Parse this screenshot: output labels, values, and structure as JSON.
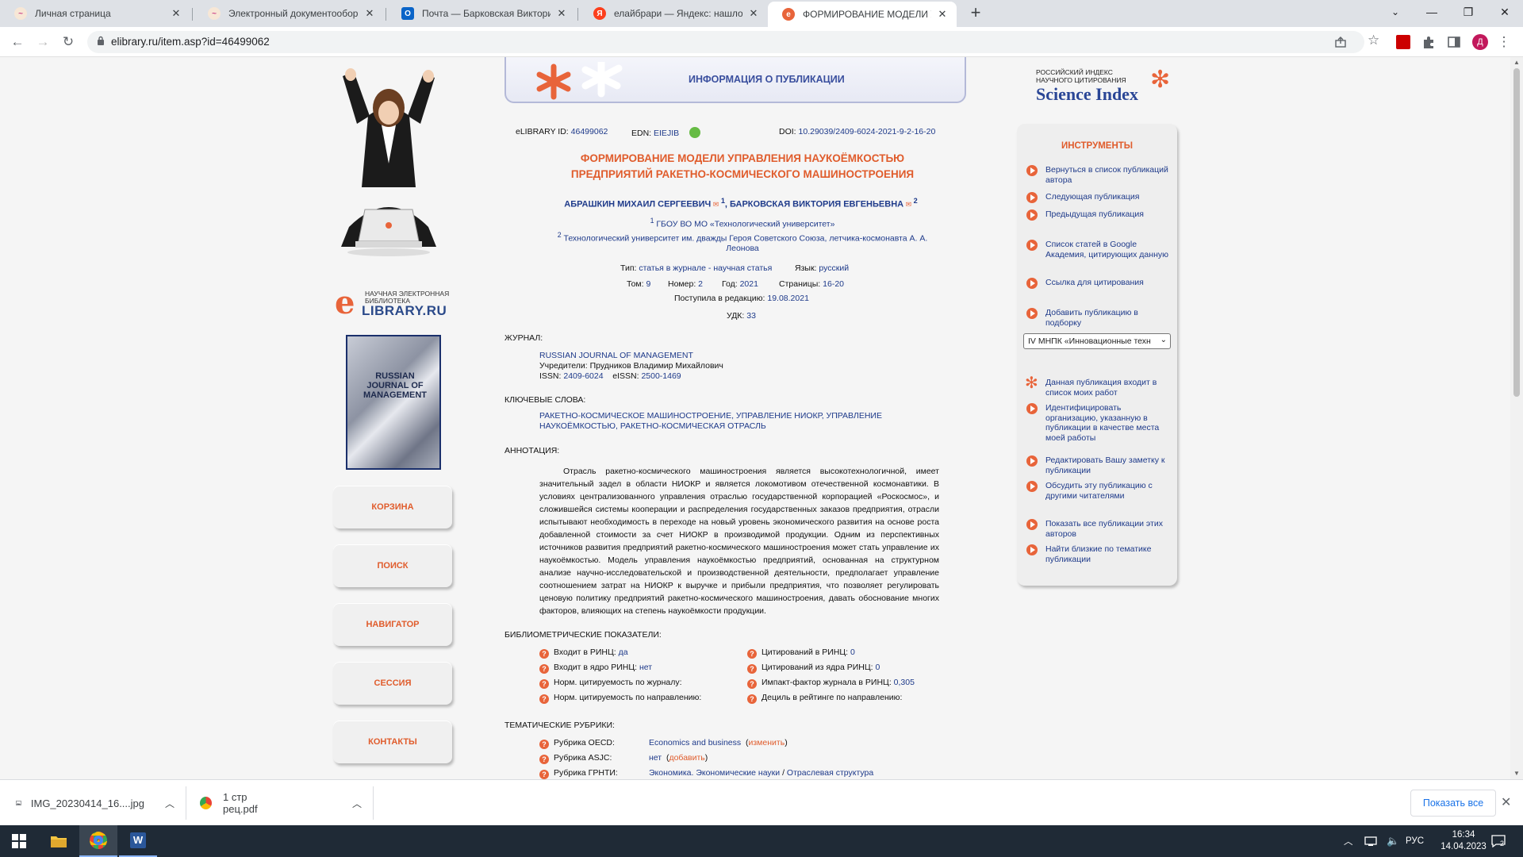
{
  "browser": {
    "tabs": [
      {
        "title": "Личная страница",
        "active": false
      },
      {
        "title": "Электронный документооборот",
        "active": false
      },
      {
        "title": "Почта — Барковская Виктория",
        "active": false
      },
      {
        "title": "елайбрари — Яндекс: нашлось",
        "active": false
      },
      {
        "title": "ФОРМИРОВАНИЕ МОДЕЛИ УПРА",
        "active": true
      }
    ],
    "url": "elibrary.ru/item.asp?id=46499062",
    "profile_initial": "Д"
  },
  "left": {
    "logo_small": "НАУЧНАЯ ЭЛЕКТРОННАЯ БИБЛИОТЕКА",
    "logo_big": "LIBRARY.RU",
    "logo_e": "e",
    "cover_title": "RUSSIAN JOURNAL OF MANAGEMENT",
    "nav": [
      "КОРЗИНА",
      "ПОИСК",
      "НАВИГАТОР",
      "СЕССИЯ",
      "КОНТАКТЫ"
    ]
  },
  "banner": {
    "title": "ИНФОРМАЦИЯ О ПУБЛИКАЦИИ"
  },
  "publication": {
    "elibrary_id_label": "eLIBRARY ID:",
    "elibrary_id": "46499062",
    "edn_label": "EDN:",
    "edn": "EIEJIB",
    "doi_label": "DOI:",
    "doi": "10.29039/2409-6024-2021-9-2-16-20",
    "title_line1": "ФОРМИРОВАНИЕ МОДЕЛИ УПРАВЛЕНИЯ НАУКОЁМКОСТЬЮ",
    "title_line2": "ПРЕДПРИЯТИЙ РАКЕТНО-КОСМИЧЕСКОГО МАШИНОСТРОЕНИЯ",
    "author1": "АБРАШКИН МИХАИЛ СЕРГЕЕВИЧ",
    "author1_sup": "1",
    "author2": "БАРКОВСКАЯ ВИКТОРИЯ ЕВГЕНЬЕВНА",
    "author2_sup": "2",
    "aff1_num": "1",
    "aff1": "ГБОУ ВО МО «Технологический университет»",
    "aff2_num": "2",
    "aff2": "Технологический университет им. дважды Героя Советского Союза, летчика-космонавта А. А. Леонова",
    "type_label": "Тип:",
    "type": "статья в журнале - научная статья",
    "lang_label": "Язык:",
    "lang": "русский",
    "vol_label": "Том:",
    "vol": "9",
    "num_label": "Номер:",
    "num": "2",
    "year_label": "Год:",
    "year": "2021",
    "pages_label": "Страницы:",
    "pages": "16-20",
    "received_label": "Поступила в редакцию:",
    "received": "19.08.2021",
    "udk_label": "УДК:",
    "udk": "33"
  },
  "journal": {
    "section": "ЖУРНАЛ:",
    "name": "RUSSIAN JOURNAL OF MANAGEMENT",
    "founder_label": "Учредители:",
    "founder": "Прудников Владимир Михайлович",
    "issn_label": "ISSN:",
    "issn": "2409-6024",
    "eissn_label": "eISSN:",
    "eissn": "2500-1469"
  },
  "keywords": {
    "section": "КЛЮЧЕВЫЕ СЛОВА:",
    "line1": "РАКЕТНО-КОСМИЧЕСКОЕ МАШИНОСТРОЕНИЕ, УПРАВЛЕНИЕ НИОКР, УПРАВЛЕНИЕ",
    "line2": "НАУКОЁМКОСТЬЮ, РАКЕТНО-КОСМИЧЕСКАЯ ОТРАСЛЬ"
  },
  "abstract": {
    "section": "АННОТАЦИЯ:",
    "text": "Отрасль ракетно-космического машиностроения является высокотехнологичной, имеет значительный задел в области НИОКР и является локомотивом отечественной космонавтики. В условиях централизованного управления отраслью государственной корпорацией «Роскосмос», и сложившейся системы кооперации и распределения государственных заказов предприятия, отрасли испытывают необходимость в переходе на новый уровень экономического развития на основе роста добавленной стоимости за счет НИОКР в производимой продукции. Одним из перспективных источников развития предприятий ракетно-космического машиностроения может стать управление их наукоёмкостью. Модель управления наукоёмкостью предприятий, основанная на структурном анализе научно-исследовательской и производственной деятельности, предполагает управление соотношением затрат на НИОКР к выручке и прибыли предприятия, что позволяет регулировать ценовую политику предприятий ракетно-космического машиностроения, давать обоснование многих факторов, влияющих на степень наукоёмкости продукции."
  },
  "bibliometrics": {
    "section": "БИБЛИОМЕТРИЧЕСКИЕ ПОКАЗАТЕЛИ:",
    "rinc_label": "Входит в РИНЦ:",
    "rinc": "да",
    "core_label": "Входит в ядро РИНЦ:",
    "core": "нет",
    "norm_journal_label": "Норм. цитируемость по журналу:",
    "norm_dir_label": "Норм. цитируемость по направлению:",
    "cit_label": "Цитирований в РИНЦ:",
    "cit": "0",
    "cit_core_label": "Цитирований из ядра РИНЦ:",
    "cit_core": "0",
    "if_label": "Импакт-фактор журнала в РИНЦ:",
    "if": "0,305",
    "decile_label": "Дециль в рейтинге по направлению:"
  },
  "rubrics": {
    "section": "ТЕМАТИЧЕСКИЕ РУБРИКИ:",
    "oecd_label": "Рубрика OECD:",
    "oecd": "Economics and business",
    "oecd_action": "изменить",
    "asjc_label": "Рубрика ASJC:",
    "asjc": "нет",
    "asjc_action": "добавить",
    "grnti_label": "Рубрика ГРНТИ:",
    "grnti_a": "Экономика. Экономические науки",
    "grnti_sep": " / ",
    "grnti_b": "Отраслевая структура"
  },
  "right": {
    "logo_line1": "РОССИЙСКИЙ ИНДЕКС",
    "logo_line2": "НАУЧНОГО ЦИТИРОВАНИЯ",
    "logo_big": "Science Index",
    "tools_title": "ИНСТРУМЕНТЫ",
    "items": [
      "Вернуться в список публикаций автора",
      "Следующая публикация",
      "Предыдущая публикация",
      "Список статей в Google Академия, цитирующих данную",
      "Ссылка для цитирования",
      "Добавить публикацию в подборку"
    ],
    "select_value": "IV МНПК «Инновационные техн",
    "items2": [
      "Данная публикация входит в список моих работ",
      "Идентифицировать организацию, указанную в публикации в качестве места моей работы",
      "Редактировать Вашу заметку к публикации",
      "Обсудить эту публикацию с другими читателями",
      "Показать все публикации этих авторов",
      "Найти близкие по тематике публикации"
    ]
  },
  "downloads": {
    "file1": "IMG_20230414_16....jpg",
    "file2": "1 стр рец.pdf",
    "show_all": "Показать все"
  },
  "taskbar": {
    "lang": "РУС",
    "time": "16:34",
    "date": "14.04.2023",
    "notif": "2"
  }
}
